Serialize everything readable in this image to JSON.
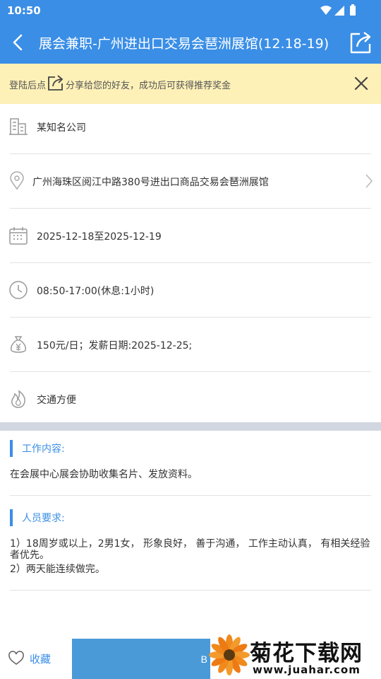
{
  "status": {
    "time": "10:50"
  },
  "header": {
    "title": "展会兼职-广州进出口交易会琶洲展馆(12.18-19)"
  },
  "notice": {
    "text_before": "登陆后点",
    "text_after": "分享给您的好友，成功后可获得推荐奖金"
  },
  "info": {
    "company": "某知名公司",
    "address": "广州海珠区阅江中路380号进出口商品交易会琶洲展馆",
    "dates": "2025-12-18至2025-12-19",
    "hours": "08:50-17:00(休息:1小时)",
    "salary": "150元/日；发薪日期:2025-12-25;",
    "welfare": "交通方便"
  },
  "job_content": {
    "heading": "工作内容:",
    "body": "在会展中心展会协助收集名片、发放资料。"
  },
  "requirements": {
    "heading": "人员要求:",
    "line1": "1）18周岁或以上，2男1女， 形象良好， 善于沟通， 工作主动认真， 有相关经验者优先。",
    "line2": "2）两天能连续做完。"
  },
  "bottom": {
    "favorite_label": "收藏",
    "apply_label": "B"
  },
  "watermark": {
    "title": "菊花下载网",
    "url": "www.juahar.com"
  },
  "colors": {
    "primary": "#3a8ee6",
    "notice_bg": "#fdf1b8",
    "separator": "#d1d7e0"
  }
}
